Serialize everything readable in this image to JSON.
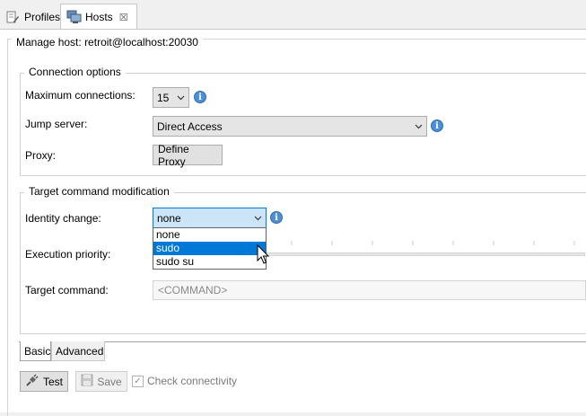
{
  "tabs": {
    "profiles_label": "Profiles",
    "hosts_label": "Hosts",
    "close_glyph": "☒"
  },
  "manage_host": {
    "label": "Manage host:",
    "value": "retroit@localhost:20030"
  },
  "connection_options": {
    "legend": "Connection options",
    "max_connections_label": "Maximum connections:",
    "max_connections_value": "15",
    "jump_server_label": "Jump server:",
    "jump_server_value": "Direct Access",
    "proxy_label": "Proxy:",
    "define_proxy_button": "Define Proxy"
  },
  "target_command_modification": {
    "legend": "Target command modification",
    "identity_change_label": "Identity change:",
    "identity_change_value": "none",
    "identity_options": [
      "none",
      "sudo",
      "sudo su"
    ],
    "highlighted_option": "sudo",
    "execution_priority_label": "Execution priority:",
    "target_command_label": "Target command:",
    "target_command_placeholder": "<COMMAND>"
  },
  "bottom_tabs": {
    "basic_label": "Basic",
    "advanced_label": "Advanced",
    "selected": "Basic"
  },
  "actions": {
    "test_label": "Test",
    "save_label": "Save",
    "check_connectivity_label": "Check connectivity",
    "check_connectivity_checked": true
  },
  "icons": {
    "info": "info-icon",
    "info_glyph": "i"
  },
  "colors": {
    "accent": "#0078d7",
    "info": "#4e8ed6"
  }
}
